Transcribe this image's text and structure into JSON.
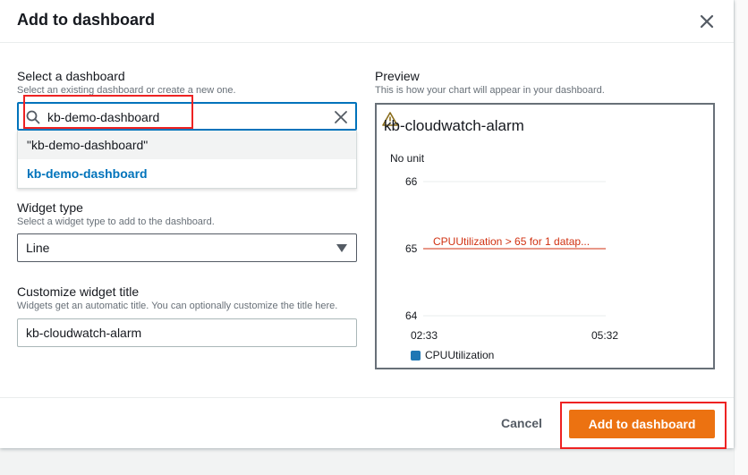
{
  "modal": {
    "title": "Add to dashboard"
  },
  "dashboard_select": {
    "label": "Select a dashboard",
    "description": "Select an existing dashboard or create a new one.",
    "search_value": "kb-demo-dashboard",
    "options": [
      "\"kb-demo-dashboard\"",
      "kb-demo-dashboard"
    ]
  },
  "widget_type": {
    "label": "Widget type",
    "description": "Select a widget type to add to the dashboard.",
    "selected": "Line"
  },
  "widget_title": {
    "label": "Customize widget title",
    "description": "Widgets get an automatic title. You can optionally customize the title here.",
    "value": "kb-cloudwatch-alarm"
  },
  "preview": {
    "label": "Preview",
    "description": "This is how your chart will appear in your dashboard.",
    "chart_title": "kb-cloudwatch-alarm",
    "unit_label": "No unit"
  },
  "chart_data": {
    "type": "line",
    "title": "kb-cloudwatch-alarm",
    "ylabel": "No unit",
    "ylim": [
      64,
      66
    ],
    "y_ticks": [
      "66",
      "65",
      "64"
    ],
    "x_ticks": [
      "02:33",
      "05:32"
    ],
    "series": [
      {
        "name": "CPUUtilization",
        "values": []
      }
    ],
    "threshold": {
      "value": 65,
      "label": "CPUUtilization > 65 for 1 datap..."
    },
    "legend": "bottom-left",
    "grid": true
  },
  "footer": {
    "cancel_label": "Cancel",
    "primary_label": "Add to dashboard"
  },
  "colors": {
    "primary": "#ec7211",
    "focus": "#0073bb",
    "threshold": "#d13212",
    "series": "#1f77b4",
    "highlight": "#e22222"
  },
  "icons": {
    "close": "close-icon",
    "search": "search-icon",
    "clear": "clear-icon",
    "caret": "caret-down-icon",
    "alarm": "warning-icon"
  }
}
